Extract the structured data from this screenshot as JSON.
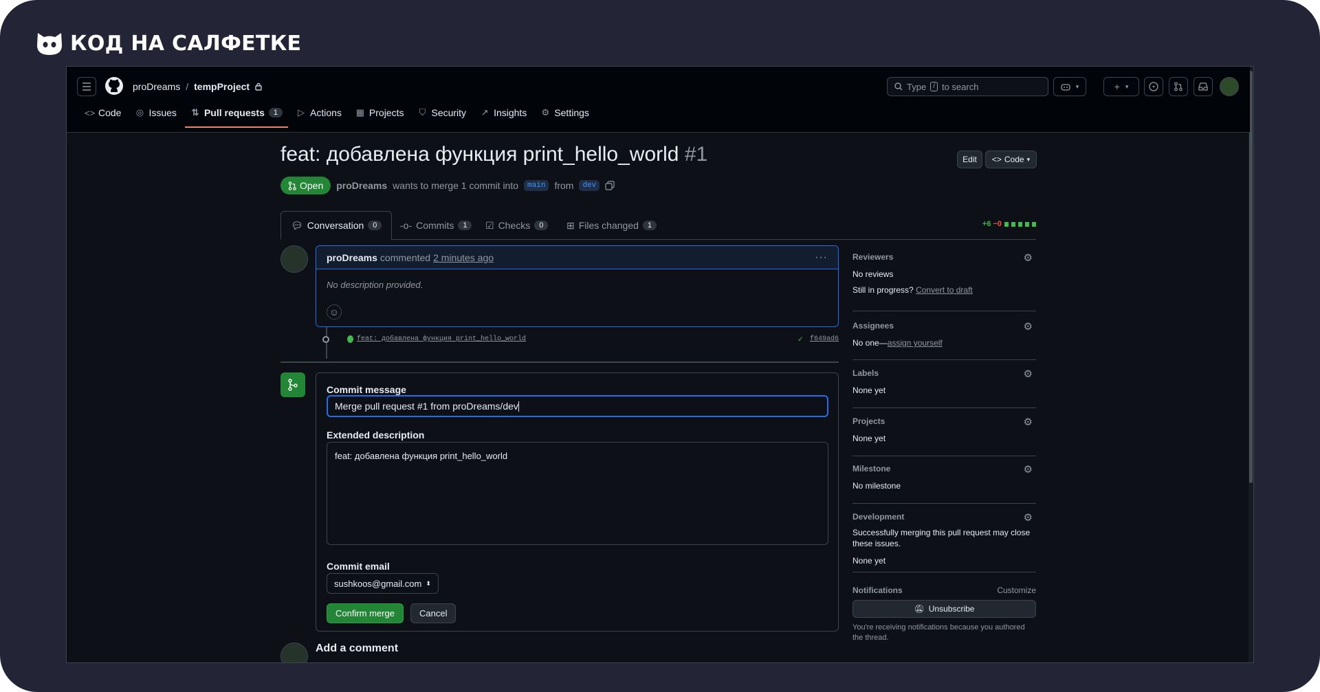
{
  "brand": {
    "name": "КОД НА САЛФЕТКЕ"
  },
  "header": {
    "owner": "proDreams",
    "separator": "/",
    "repo": "tempProject",
    "search_prefix": "Type",
    "search_key": "/",
    "search_suffix": "to search"
  },
  "repo_nav": [
    {
      "label": "Code",
      "icon": "code-icon"
    },
    {
      "label": "Issues",
      "icon": "issue-icon"
    },
    {
      "label": "Pull requests",
      "icon": "pull-request-icon",
      "count": "1"
    },
    {
      "label": "Actions",
      "icon": "play-icon"
    },
    {
      "label": "Projects",
      "icon": "table-icon"
    },
    {
      "label": "Security",
      "icon": "shield-icon"
    },
    {
      "label": "Insights",
      "icon": "graph-icon"
    },
    {
      "label": "Settings",
      "icon": "gear-icon"
    }
  ],
  "pr": {
    "title": "feat: добавлена функция print_hello_world",
    "number": "#1",
    "edit_label": "Edit",
    "code_label": "Code",
    "state": "Open",
    "author": "proDreams",
    "merge_text_1": "wants to merge 1 commit into",
    "base": "main",
    "from": "from",
    "head": "dev"
  },
  "pr_tabs": [
    {
      "label": "Conversation",
      "count": "0"
    },
    {
      "label": "Commits",
      "count": "1"
    },
    {
      "label": "Checks",
      "count": "0"
    },
    {
      "label": "Files changed",
      "count": "1"
    }
  ],
  "diffstat": {
    "additions": "+6",
    "deletions": "−0"
  },
  "comment": {
    "author": "proDreams",
    "action": "commented",
    "time": "2 minutes ago",
    "body": "No description provided."
  },
  "commit": {
    "message": "feat: добавлена функция print_hello_world",
    "sha": "f649ad6"
  },
  "merge": {
    "commit_message_label": "Commit message",
    "commit_message_value": "Merge pull request #1 from proDreams/dev",
    "ext_desc_label": "Extended description",
    "ext_desc_value": "feat: добавлена функция print_hello_world",
    "email_label": "Commit email",
    "email_value": "sushkoos@gmail.com",
    "confirm_label": "Confirm merge",
    "cancel_label": "Cancel"
  },
  "add_comment": "Add a comment",
  "sidebar": {
    "reviewers": {
      "title": "Reviewers",
      "text": "No reviews",
      "progress": "Still in progress?",
      "draft_link": "Convert to draft"
    },
    "assignees": {
      "title": "Assignees",
      "text": "No one—",
      "link": "assign yourself"
    },
    "labels": {
      "title": "Labels",
      "text": "None yet"
    },
    "projects": {
      "title": "Projects",
      "text": "None yet"
    },
    "milestone": {
      "title": "Milestone",
      "text": "No milestone"
    },
    "development": {
      "title": "Development",
      "text": "Successfully merging this pull request may close these issues.",
      "text2": "None yet"
    },
    "notifications": {
      "title": "Notifications",
      "customize": "Customize",
      "button": "Unsubscribe",
      "note": "You're receiving notifications because you authored the thread."
    }
  }
}
